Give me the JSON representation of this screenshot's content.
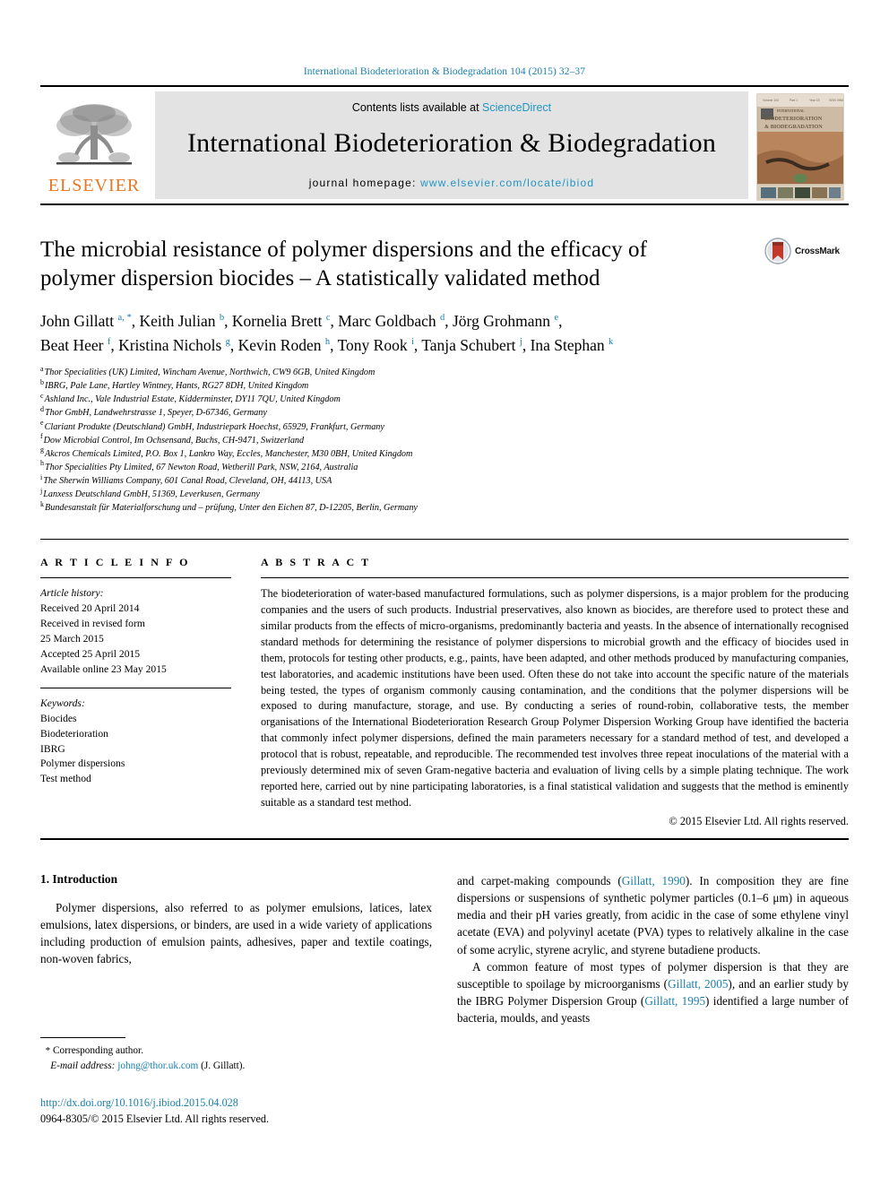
{
  "running_head": "International Biodeterioration & Biodegradation 104 (2015) 32–37",
  "masthead": {
    "publisher_name": "ELSEVIER",
    "contents_prefix": "Contents lists available at ",
    "contents_link": "ScienceDirect",
    "journal_name": "International Biodeterioration & Biodegradation",
    "homepage_prefix": "journal homepage: ",
    "homepage_url": "www.elsevier.com/locate/ibiod",
    "cover_title_line1": "BIODETERIORATION",
    "cover_title_line2": "& BIODEGRADATION"
  },
  "article": {
    "title": "The microbial resistance of polymer dispersions and the efficacy of polymer dispersion biocides – A statistically validated method",
    "crossmark_label": "CrossMark",
    "authors_line1": "John Gillatt ᵃ, *, Keith Julian ᵇ, Kornelia Brett ᶜ, Marc Goldbach ᵈ, Jörg Grohmann ᵉ,",
    "authors_line2": "Beat Heer ᶠ, Kristina Nichols ᵍ, Kevin Roden ʰ, Tony Rook ⁱ, Tanja Schubert ʲ, Ina Stephan ᵏ",
    "authors": [
      {
        "name": "John Gillatt",
        "marks": "a, *"
      },
      {
        "name": "Keith Julian",
        "marks": "b"
      },
      {
        "name": "Kornelia Brett",
        "marks": "c"
      },
      {
        "name": "Marc Goldbach",
        "marks": "d"
      },
      {
        "name": "Jörg Grohmann",
        "marks": "e"
      },
      {
        "name": "Beat Heer",
        "marks": "f"
      },
      {
        "name": "Kristina Nichols",
        "marks": "g"
      },
      {
        "name": "Kevin Roden",
        "marks": "h"
      },
      {
        "name": "Tony Rook",
        "marks": "i"
      },
      {
        "name": "Tanja Schubert",
        "marks": "j"
      },
      {
        "name": "Ina Stephan",
        "marks": "k"
      }
    ],
    "affiliations": [
      {
        "mark": "a",
        "text": "Thor Specialities (UK) Limited, Wincham Avenue, Northwich, CW9 6GB, United Kingdom"
      },
      {
        "mark": "b",
        "text": "IBRG, Pale Lane, Hartley Wintney, Hants, RG27 8DH, United Kingdom"
      },
      {
        "mark": "c",
        "text": "Ashland Inc., Vale Industrial Estate, Kidderminster, DY11 7QU, United Kingdom"
      },
      {
        "mark": "d",
        "text": "Thor GmbH, Landwehrstrasse 1, Speyer, D-67346, Germany"
      },
      {
        "mark": "e",
        "text": "Clariant Produkte (Deutschland) GmbH, Industriepark Hoechst, 65929, Frankfurt, Germany"
      },
      {
        "mark": "f",
        "text": "Dow Microbial Control, Im Ochsensand, Buchs, CH-9471, Switzerland"
      },
      {
        "mark": "g",
        "text": "Akcros Chemicals Limited, P.O. Box 1, Lankro Way, Eccles, Manchester, M30 0BH, United Kingdom"
      },
      {
        "mark": "h",
        "text": "Thor Specialities Pty Limited, 67 Newton Road, Wetherill Park, NSW, 2164, Australia"
      },
      {
        "mark": "i",
        "text": "The Sherwin Williams Company, 601 Canal Road, Cleveland, OH, 44113, USA"
      },
      {
        "mark": "j",
        "text": "Lanxess Deutschland GmbH, 51369, Leverkusen, Germany"
      },
      {
        "mark": "k",
        "text": "Bundesanstalt für Materialforschung und – prüfung, Unter den Eichen 87, D-12205, Berlin, Germany"
      }
    ]
  },
  "article_info": {
    "heading": "A R T I C L E   I N F O",
    "history_label": "Article history:",
    "history": [
      "Received 20 April 2014",
      "Received in revised form",
      "25 March 2015",
      "Accepted 25 April 2015",
      "Available online 23 May 2015"
    ],
    "keywords_label": "Keywords:",
    "keywords": [
      "Biocides",
      "Biodeterioration",
      "IBRG",
      "Polymer dispersions",
      "Test method"
    ]
  },
  "abstract": {
    "heading": "A B S T R A C T",
    "text": "The biodeterioration of water-based manufactured formulations, such as polymer dispersions, is a major problem for the producing companies and the users of such products. Industrial preservatives, also known as biocides, are therefore used to protect these and similar products from the effects of micro-organisms, predominantly bacteria and yeasts. In the absence of internationally recognised standard methods for determining the resistance of polymer dispersions to microbial growth and the efficacy of biocides used in them, protocols for testing other products, e.g., paints, have been adapted, and other methods produced by manufacturing companies, test laboratories, and academic institutions have been used. Often these do not take into account the specific nature of the materials being tested, the types of organism commonly causing contamination, and the conditions that the polymer dispersions will be exposed to during manufacture, storage, and use. By conducting a series of round-robin, collaborative tests, the member organisations of the International Biodeterioration Research Group Polymer Dispersion Working Group have identified the bacteria that commonly infect polymer dispersions, defined the main parameters necessary for a standard method of test, and developed a protocol that is robust, repeatable, and reproducible. The recommended test involves three repeat inoculations of the material with a previously determined mix of seven Gram-negative bacteria and evaluation of living cells by a simple plating technique. The work reported here, carried out by nine participating laboratories, is a final statistical validation and suggests that the method is eminently suitable as a standard test method.",
    "copyright": "© 2015 Elsevier Ltd. All rights reserved."
  },
  "introduction": {
    "section_number_title": "1. Introduction",
    "para1_left": "Polymer dispersions, also referred to as polymer emulsions, latices, latex emulsions, latex dispersions, or binders, are used in a wide variety of applications including production of emulsion paints, adhesives, paper and textile coatings, non-woven fabrics,",
    "para1_right_a": "and carpet-making compounds (",
    "para1_ref1": "Gillatt, 1990",
    "para1_right_b": "). In composition they are fine dispersions or suspensions of synthetic polymer particles (0.1–6 μm) in aqueous media and their pH varies greatly, from acidic in the case of some ethylene vinyl acetate (EVA) and polyvinyl acetate (PVA) types to relatively alkaline in the case of some acrylic, styrene acrylic, and styrene butadiene products.",
    "para2_a": "A common feature of most types of polymer dispersion is that they are susceptible to spoilage by microorganisms (",
    "para2_ref1": "Gillatt, 2005",
    "para2_b": "), and an earlier study by the IBRG Polymer Dispersion Group (",
    "para2_ref2": "Gillatt, 1995",
    "para2_c": ") identified a large number of bacteria, moulds, and yeasts"
  },
  "footer": {
    "corresponding_star": "*",
    "corresponding_label": "Corresponding author.",
    "email_label": "E-mail address:",
    "email": "johng@thor.uk.com",
    "email_owner": "(J. Gillatt).",
    "doi_url": "http://dx.doi.org/10.1016/j.ibiod.2015.04.028",
    "issn_line": "0964-8305/© 2015 Elsevier Ltd. All rights reserved."
  },
  "colors": {
    "link_blue": "#1a7fab",
    "sciencedirect_blue": "#2196c4",
    "elsevier_orange": "#E87722"
  }
}
